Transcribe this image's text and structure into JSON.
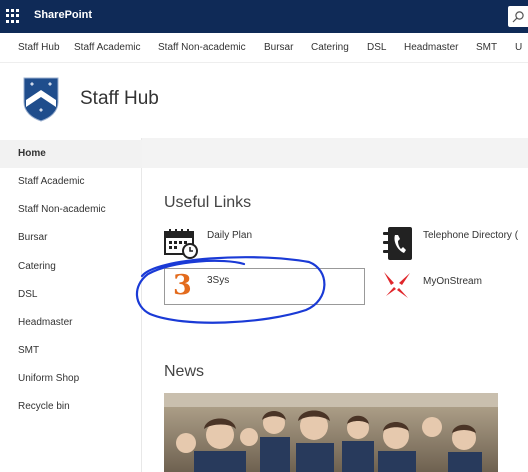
{
  "suite": {
    "brand": "SharePoint"
  },
  "hub_nav": [
    "Staff Hub",
    "Staff Academic",
    "Staff Non-academic",
    "Bursar",
    "Catering",
    "DSL",
    "Headmaster",
    "SMT",
    "U"
  ],
  "site": {
    "title": "Staff Hub"
  },
  "left_nav": [
    "Home",
    "Staff Academic",
    "Staff Non-academic",
    "Bursar",
    "Catering",
    "DSL",
    "Headmaster",
    "SMT",
    "Uniform Shop",
    "Recycle bin"
  ],
  "useful_links": {
    "title": "Useful Links",
    "items": [
      {
        "label": "Daily Plan",
        "icon": "calendar-clock-icon"
      },
      {
        "label": "Telephone Directory (",
        "icon": "phone-book-icon"
      },
      {
        "label": "3Sys",
        "icon": "3sys-logo"
      },
      {
        "label": "MyOnStream",
        "icon": "onstream-logo"
      }
    ]
  },
  "news": {
    "title": "News"
  },
  "colors": {
    "suite_bar": "#0f2a57",
    "logo_blue": "#1f4d8c",
    "three_orange": "#e36b1d",
    "onstream_red": "#e0262b",
    "annotation": "#1a3ad6"
  }
}
